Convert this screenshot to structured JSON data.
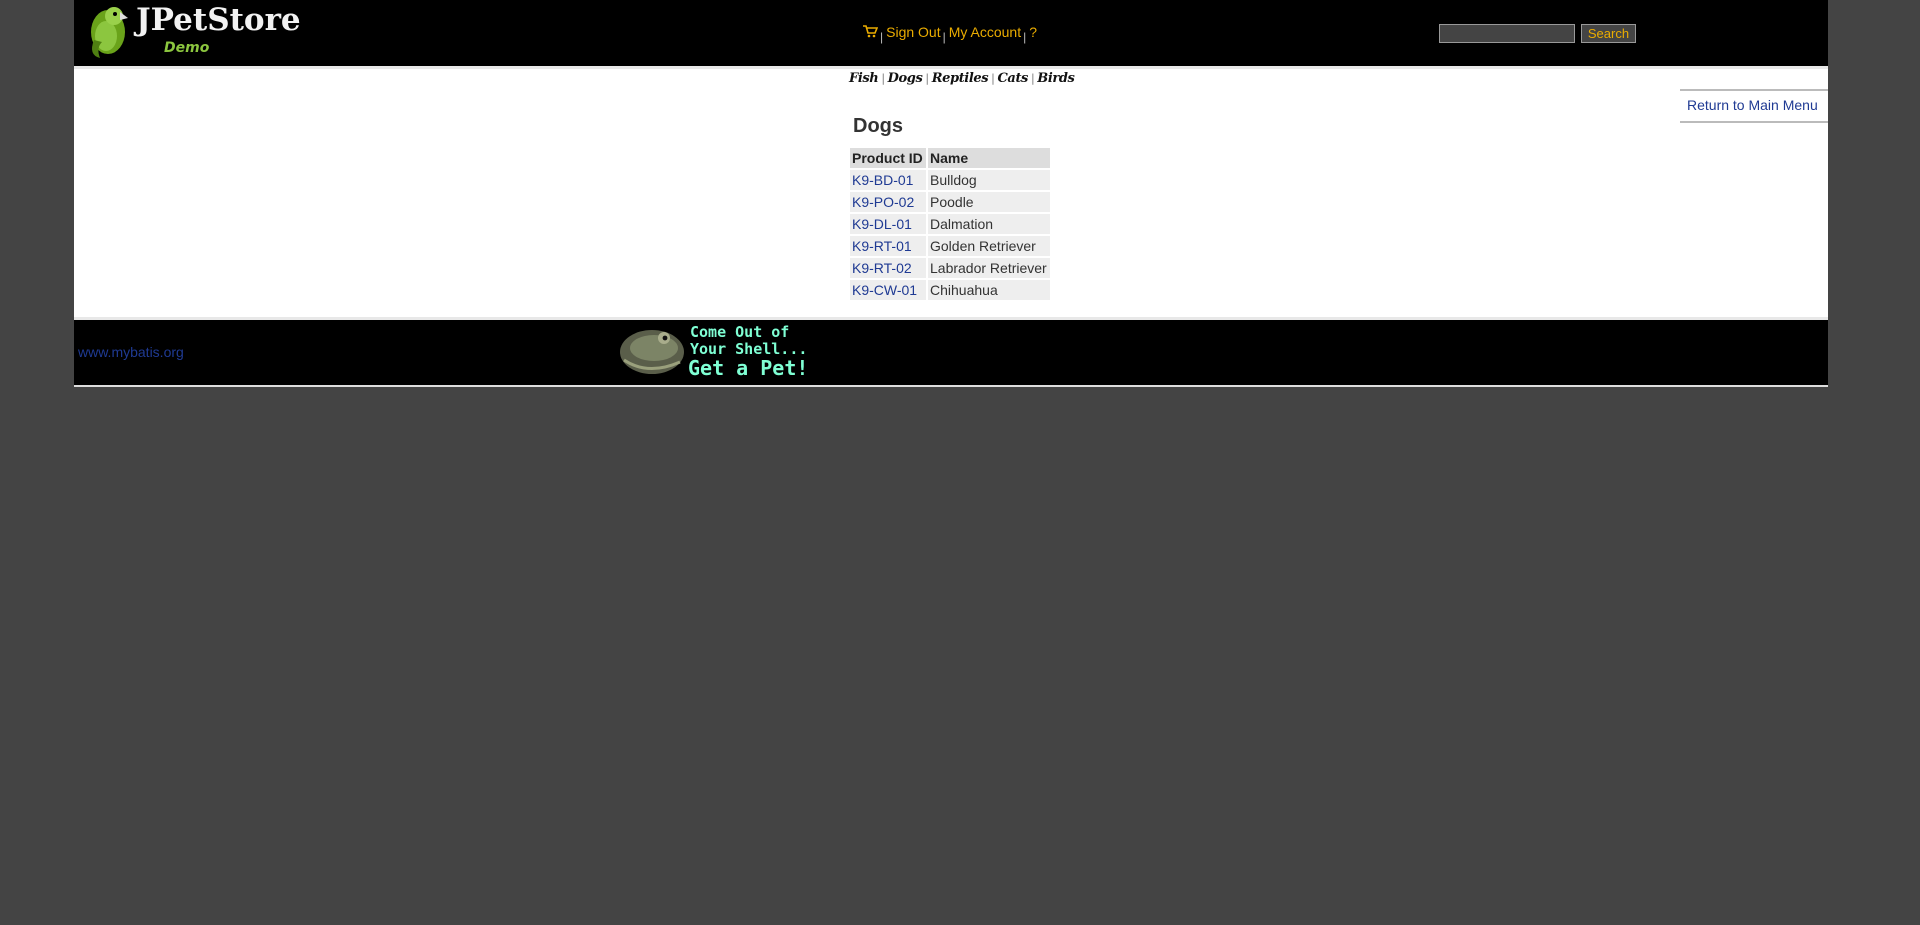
{
  "header": {
    "logo_text": "JPetStore",
    "logo_sub": "Demo",
    "menu": {
      "cart_icon": "cart-icon",
      "sign_out": "Sign Out",
      "my_account": "My Account",
      "help": "?",
      "separator": "|"
    },
    "search": {
      "value": "",
      "button_label": "Search"
    }
  },
  "quicklinks": [
    "Fish",
    "Dogs",
    "Reptiles",
    "Cats",
    "Birds"
  ],
  "back_link": "Return to Main Menu",
  "catalog": {
    "title": "Dogs",
    "columns": [
      "Product ID",
      "Name"
    ],
    "rows": [
      {
        "id": "K9-BD-01",
        "name": "Bulldog"
      },
      {
        "id": "K9-PO-02",
        "name": "Poodle"
      },
      {
        "id": "K9-DL-01",
        "name": "Dalmation"
      },
      {
        "id": "K9-RT-01",
        "name": "Golden Retriever"
      },
      {
        "id": "K9-RT-02",
        "name": "Labrador Retriever"
      },
      {
        "id": "K9-CW-01",
        "name": "Chihuahua"
      }
    ]
  },
  "footer": {
    "powered_by": "www.mybatis.org",
    "banner": {
      "line1": "Come Out of",
      "line2": "Your Shell...",
      "line3": "Get a Pet!"
    }
  },
  "colors": {
    "background": "#444444",
    "header_bg": "#000000",
    "menu_link": "#eaac00",
    "link": "#1f3a93",
    "banner_text": "#7fffd4"
  }
}
